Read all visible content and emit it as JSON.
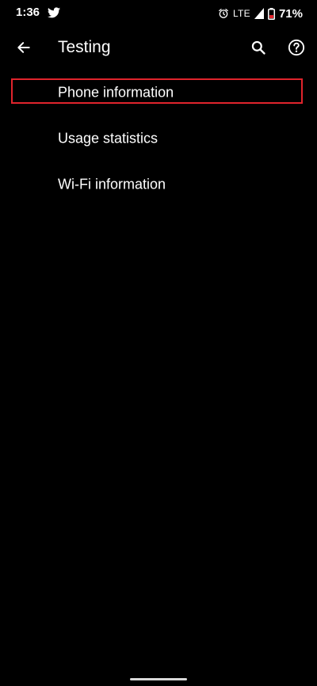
{
  "status_bar": {
    "time": "1:36",
    "network": "LTE",
    "battery_percent": "71%",
    "battery_level": 0.71,
    "icons": [
      "twitter-icon",
      "alarm-icon",
      "signal-icon",
      "battery-icon"
    ]
  },
  "toolbar": {
    "title": "Testing",
    "icons": [
      "back-arrow-icon",
      "search-icon",
      "help-icon"
    ]
  },
  "list": {
    "items": [
      {
        "label": "Phone information",
        "highlighted": true
      },
      {
        "label": "Usage statistics",
        "highlighted": false
      },
      {
        "label": "Wi-Fi information",
        "highlighted": false
      }
    ]
  },
  "colors": {
    "background": "#000000",
    "text": "#ffffff",
    "highlight": "#e0242c",
    "battery_low": "#e0242c",
    "nav_handle": "#d8d8d8"
  }
}
